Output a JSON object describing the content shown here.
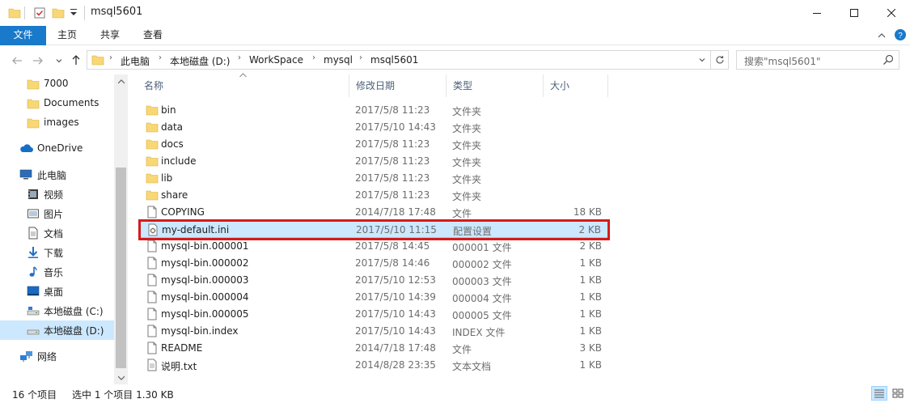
{
  "window": {
    "title": "msql5601",
    "colors": {
      "accent": "#1979ca",
      "selection": "#cce8ff",
      "highlight_box": "#d51b1b"
    }
  },
  "ribbon": {
    "tabs": [
      {
        "label": "文件"
      },
      {
        "label": "主页"
      },
      {
        "label": "共享"
      },
      {
        "label": "查看"
      }
    ]
  },
  "address": {
    "crumbs": [
      "此电脑",
      "本地磁盘 (D:)",
      "WorkSpace",
      "mysql",
      "msql5601"
    ]
  },
  "search": {
    "placeholder": "搜索\"msql5601\""
  },
  "navpane": {
    "items": [
      {
        "label": "7000",
        "icon": "folder-icon"
      },
      {
        "label": "Documents",
        "icon": "folder-icon"
      },
      {
        "label": "images",
        "icon": "folder-icon"
      },
      {
        "label": "OneDrive",
        "icon": "cloud-icon"
      },
      {
        "label": "此电脑",
        "icon": "computer-icon"
      },
      {
        "label": "视频",
        "icon": "video-icon"
      },
      {
        "label": "图片",
        "icon": "pictures-icon"
      },
      {
        "label": "文档",
        "icon": "documents-icon"
      },
      {
        "label": "下载",
        "icon": "download-icon"
      },
      {
        "label": "音乐",
        "icon": "music-icon"
      },
      {
        "label": "桌面",
        "icon": "desktop-icon"
      },
      {
        "label": "本地磁盘 (C:)",
        "icon": "drive-icon"
      },
      {
        "label": "本地磁盘 (D:)",
        "icon": "drive-icon",
        "selected": true
      },
      {
        "label": "网络",
        "icon": "network-icon"
      }
    ]
  },
  "columns": {
    "name": "名称",
    "date": "修改日期",
    "type": "类型",
    "size": "大小"
  },
  "files": [
    {
      "name": "bin",
      "date": "2017/5/8 11:23",
      "type": "文件夹",
      "size": "",
      "icon": "folder-icon"
    },
    {
      "name": "data",
      "date": "2017/5/10 14:43",
      "type": "文件夹",
      "size": "",
      "icon": "folder-icon"
    },
    {
      "name": "docs",
      "date": "2017/5/8 11:23",
      "type": "文件夹",
      "size": "",
      "icon": "folder-icon"
    },
    {
      "name": "include",
      "date": "2017/5/8 11:23",
      "type": "文件夹",
      "size": "",
      "icon": "folder-icon"
    },
    {
      "name": "lib",
      "date": "2017/5/8 11:23",
      "type": "文件夹",
      "size": "",
      "icon": "folder-icon"
    },
    {
      "name": "share",
      "date": "2017/5/8 11:23",
      "type": "文件夹",
      "size": "",
      "icon": "folder-icon"
    },
    {
      "name": "COPYING",
      "date": "2014/7/18 17:48",
      "type": "文件",
      "size": "18 KB",
      "icon": "file-icon"
    },
    {
      "name": "my-default.ini",
      "date": "2017/5/10 11:15",
      "type": "配置设置",
      "size": "2 KB",
      "icon": "settings-file-icon",
      "selected": true
    },
    {
      "name": "mysql-bin.000001",
      "date": "2017/5/8 14:45",
      "type": "000001 文件",
      "size": "2 KB",
      "icon": "file-icon"
    },
    {
      "name": "mysql-bin.000002",
      "date": "2017/5/8 14:46",
      "type": "000002 文件",
      "size": "1 KB",
      "icon": "file-icon"
    },
    {
      "name": "mysql-bin.000003",
      "date": "2017/5/10 12:53",
      "type": "000003 文件",
      "size": "1 KB",
      "icon": "file-icon"
    },
    {
      "name": "mysql-bin.000004",
      "date": "2017/5/10 14:39",
      "type": "000004 文件",
      "size": "1 KB",
      "icon": "file-icon"
    },
    {
      "name": "mysql-bin.000005",
      "date": "2017/5/10 14:43",
      "type": "000005 文件",
      "size": "1 KB",
      "icon": "file-icon"
    },
    {
      "name": "mysql-bin.index",
      "date": "2017/5/10 14:43",
      "type": "INDEX 文件",
      "size": "1 KB",
      "icon": "file-icon"
    },
    {
      "name": "README",
      "date": "2014/7/18 17:48",
      "type": "文件",
      "size": "3 KB",
      "icon": "file-icon"
    },
    {
      "name": "说明.txt",
      "date": "2014/8/28 23:35",
      "type": "文本文档",
      "size": "1 KB",
      "icon": "text-file-icon"
    }
  ],
  "status": {
    "count": "16 个项目",
    "selection": "选中 1 个项目  1.30 KB"
  }
}
